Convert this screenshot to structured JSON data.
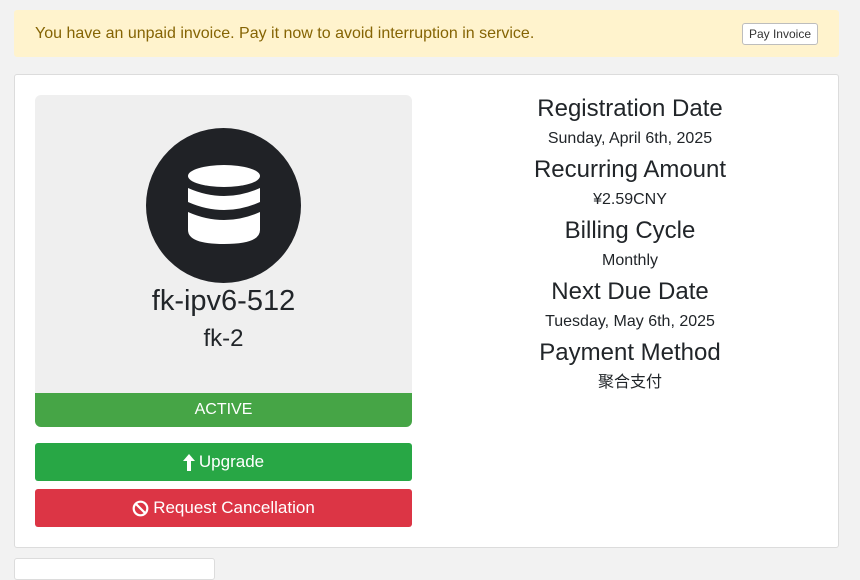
{
  "alert": {
    "message": "You have an unpaid invoice. Pay it now to avoid interruption in service.",
    "button_label": "Pay Invoice"
  },
  "product": {
    "icon": "database-icon",
    "name": "fk-ipv6-512",
    "group": "fk-2",
    "status": "ACTIVE"
  },
  "actions": {
    "upgrade_label": "Upgrade",
    "cancel_label": "Request Cancellation"
  },
  "details": [
    {
      "title": "Registration Date",
      "value": "Sunday, April 6th, 2025"
    },
    {
      "title": "Recurring Amount",
      "value": "¥2.59CNY"
    },
    {
      "title": "Billing Cycle",
      "value": "Monthly"
    },
    {
      "title": "Next Due Date",
      "value": "Tuesday, May 6th, 2025"
    },
    {
      "title": "Payment Method",
      "value": "聚合支付"
    }
  ],
  "colors": {
    "active": "#46a546",
    "upgrade": "#28a745",
    "cancel": "#dc3545",
    "alert_bg": "#fff3cd"
  }
}
